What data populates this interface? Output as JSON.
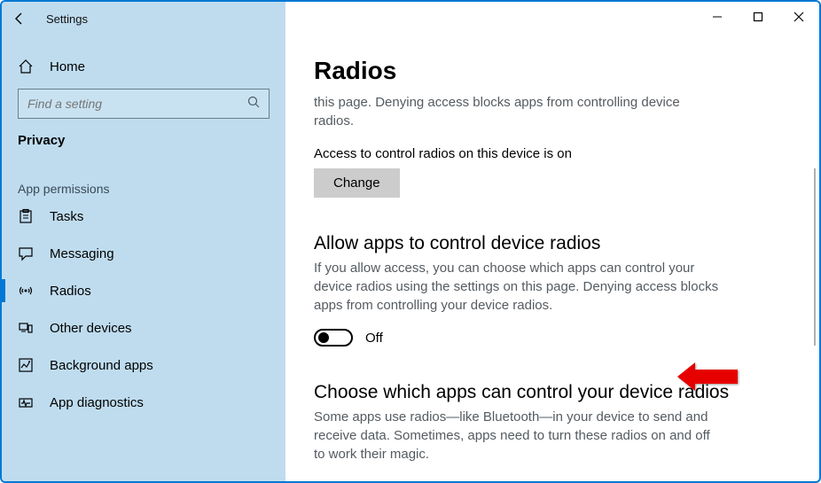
{
  "app_title": "Settings",
  "sidebar": {
    "home_label": "Home",
    "search_placeholder": "Find a setting",
    "category": "Privacy",
    "group_label": "App permissions",
    "items": [
      {
        "label": "Tasks"
      },
      {
        "label": "Messaging"
      },
      {
        "label": "Radios"
      },
      {
        "label": "Other devices"
      },
      {
        "label": "Background apps"
      },
      {
        "label": "App diagnostics"
      }
    ]
  },
  "page": {
    "title": "Radios",
    "intro_fragment": "this page. Denying access blocks apps from controlling device radios.",
    "access_status": "Access to control radios on this device is on",
    "change_label": "Change",
    "allow_title": "Allow apps to control device radios",
    "allow_desc": "If you allow access, you can choose which apps can control your device radios using the settings on this page. Denying access blocks apps from controlling your device radios.",
    "toggle_state": "Off",
    "choose_title": "Choose which apps can control your device radios",
    "choose_desc": "Some apps use radios—like Bluetooth—in your device to send and receive data. Sometimes, apps need to turn these radios on and off to work their magic."
  }
}
